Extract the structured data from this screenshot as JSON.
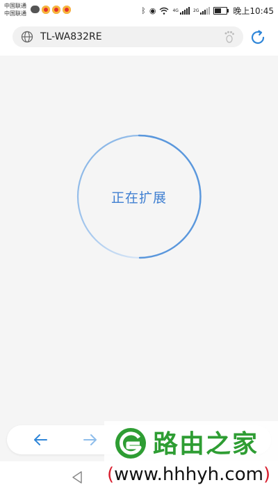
{
  "status_bar": {
    "carrier_1": "中国联通",
    "carrier_2": "中国联通",
    "network_label_1": "4G",
    "network_label_2": "2G",
    "time": "晚上10:45"
  },
  "address_bar": {
    "url": "TL-WA832RE"
  },
  "main": {
    "status_text": "正在扩展"
  },
  "watermark": {
    "title": "路由之家",
    "url_open": "(",
    "url_text": "www.hhhyh.com",
    "url_close": ")"
  },
  "colors": {
    "accent": "#3f7fd1",
    "brand_green": "#2e9d33",
    "watermark_red": "#d81e2e"
  }
}
